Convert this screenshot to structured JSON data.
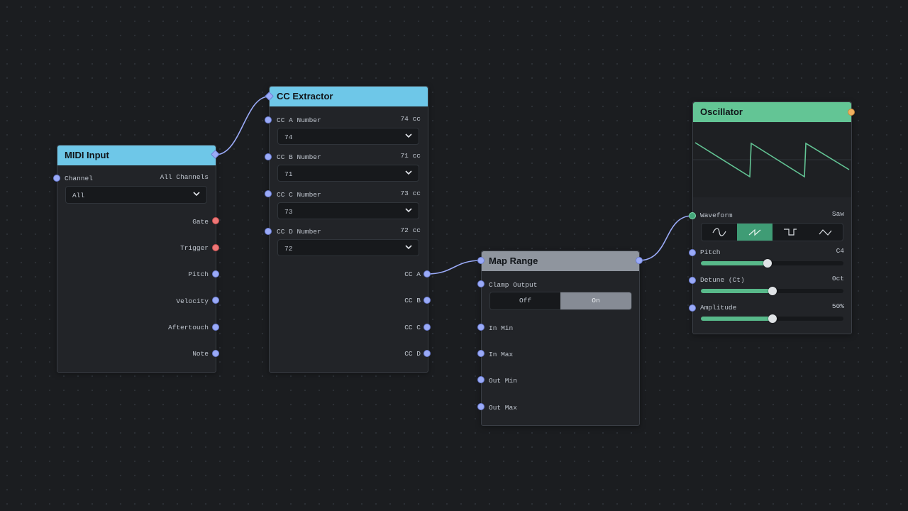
{
  "colors": {
    "header_blue": "#6ec7e8",
    "header_gray": "#8f959e",
    "header_green": "#63c595",
    "port_blue": "#9aaaf7",
    "port_red": "#ef7777",
    "port_orange": "#f0b060",
    "wire": "#9aaaf7",
    "accent_green": "#58b98a"
  },
  "midi_input": {
    "title": "MIDI Input",
    "channel_label": "Channel",
    "channel_value": "All Channels",
    "channel_select": "All",
    "outputs": [
      "Gate",
      "Trigger",
      "Pitch",
      "Velocity",
      "Aftertouch",
      "Note"
    ]
  },
  "cc_extractor": {
    "title": "CC Extractor",
    "params": [
      {
        "label": "CC A Number",
        "value": "74 cc",
        "select": "74"
      },
      {
        "label": "CC B Number",
        "value": "71 cc",
        "select": "71"
      },
      {
        "label": "CC C Number",
        "value": "73 cc",
        "select": "73"
      },
      {
        "label": "CC D Number",
        "value": "72 cc",
        "select": "72"
      }
    ],
    "outputs": [
      "CC A",
      "CC B",
      "CC C",
      "CC D"
    ]
  },
  "map_range": {
    "title": "Map Range",
    "clamp_label": "Clamp Output",
    "toggle_off": "Off",
    "toggle_on": "On",
    "toggle_selected": "On",
    "inputs": [
      "In Min",
      "In Max",
      "Out Min",
      "Out Max"
    ]
  },
  "oscillator": {
    "title": "Oscillator",
    "waveform_label": "Waveform",
    "waveform_value": "Saw",
    "waveform_options": [
      "sine-wave-icon",
      "saw-wave-icon",
      "square-wave-icon",
      "triangle-wave-icon"
    ],
    "waveform_selected_index": 1,
    "sliders": [
      {
        "label": "Pitch",
        "value": "C4",
        "level": 0.47
      },
      {
        "label": "Detune (Ct)",
        "value": "0ct",
        "level": 0.5
      },
      {
        "label": "Amplitude",
        "value": "50%",
        "level": 0.5
      }
    ]
  }
}
